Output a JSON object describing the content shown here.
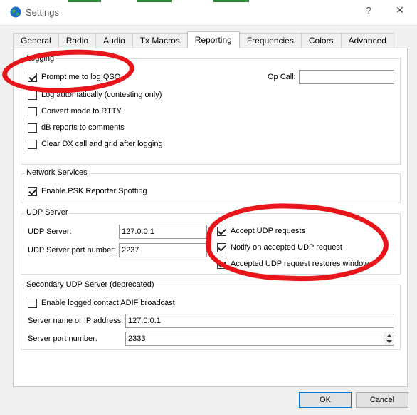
{
  "window": {
    "title": "Settings",
    "help_glyph": "?",
    "close_glyph": "✕"
  },
  "tabs": [
    {
      "label": "General",
      "active": false
    },
    {
      "label": "Radio",
      "active": false
    },
    {
      "label": "Audio",
      "active": false
    },
    {
      "label": "Tx Macros",
      "active": false
    },
    {
      "label": "Reporting",
      "active": true
    },
    {
      "label": "Frequencies",
      "active": false
    },
    {
      "label": "Colors",
      "active": false
    },
    {
      "label": "Advanced",
      "active": false
    }
  ],
  "logging": {
    "title": "Logging",
    "options": [
      {
        "label": "Prompt me to log QSO",
        "checked": true
      },
      {
        "label": "Log automatically (contesting only)",
        "checked": false
      },
      {
        "label": "Convert mode to RTTY",
        "checked": false
      },
      {
        "label": "dB reports to comments",
        "checked": false
      },
      {
        "label": "Clear DX call and grid after logging",
        "checked": false
      }
    ],
    "op_call_label": "Op Call:",
    "op_call_value": ""
  },
  "network_services": {
    "title": "Network Services",
    "psk_label": "Enable PSK Reporter Spotting",
    "psk_checked": true
  },
  "udp_server": {
    "title": "UDP Server",
    "server_label": "UDP Server:",
    "server_value": "127.0.0.1",
    "port_label": "UDP Server port number:",
    "port_value": "2237",
    "options": [
      {
        "label": "Accept UDP requests",
        "checked": true
      },
      {
        "label": "Notify on accepted UDP request",
        "checked": true
      },
      {
        "label": "Accepted UDP request restores window",
        "checked": true
      }
    ]
  },
  "secondary_udp": {
    "title": "Secondary UDP Server (deprecated)",
    "adif_label": "Enable logged contact ADIF broadcast",
    "adif_checked": false,
    "name_label": "Server name or IP address:",
    "name_value": "127.0.0.1",
    "port_label": "Server port number:",
    "port_value": "2333"
  },
  "buttons": {
    "ok": "OK",
    "cancel": "Cancel"
  },
  "colors": {
    "annotation": "#e8151b",
    "strip_green": "#2e8b3a"
  }
}
